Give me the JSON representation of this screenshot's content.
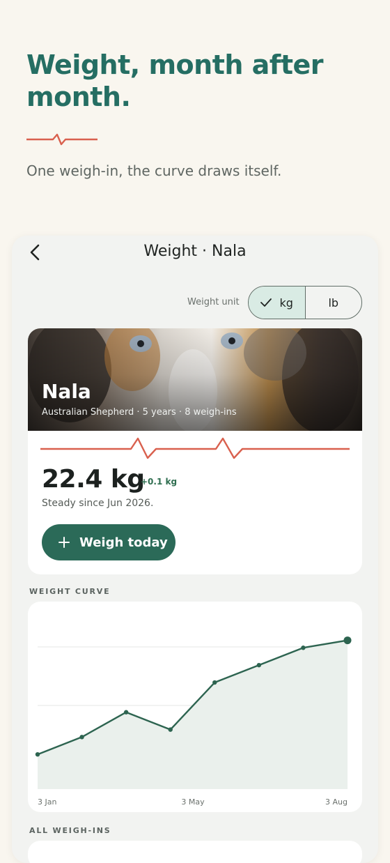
{
  "hero": {
    "title": "Weight, month after month.",
    "subtitle": "One weigh-in, the curve draws itself."
  },
  "screen": {
    "title": "Weight · Nala",
    "unit_label": "Weight unit",
    "units": [
      {
        "label": "kg",
        "selected": true
      },
      {
        "label": "lb",
        "selected": false
      }
    ]
  },
  "pet": {
    "name": "Nala",
    "meta": "Australian Shepherd · 5 years · 8 weigh-ins",
    "weight": "22.4 kg",
    "delta": "+0.1 kg",
    "status": "Steady since Jun 2026."
  },
  "actions": {
    "weigh_today": "Weigh today"
  },
  "sections": {
    "weight_curve": "WEIGHT CURVE",
    "all_weighins": "ALL WEIGH-INS"
  },
  "colors": {
    "accent": "#256e63",
    "button": "#2b6a58",
    "pulse": "#d9604e",
    "line": "#2d6450",
    "area": "#eaf0ec",
    "delta": "#2f6e50"
  },
  "icons": {
    "back": "chevron-left-icon",
    "check": "check-icon",
    "plus": "plus-icon"
  },
  "chart_data": {
    "type": "line",
    "x_tick_labels": [
      "3 Jan",
      "3 May",
      "3 Aug"
    ],
    "series": [
      {
        "values": [
          20.4,
          21.1,
          22.1,
          21.4,
          23.3,
          24.0,
          24.7,
          25.0
        ]
      }
    ],
    "ylim": [
      19,
      26
    ],
    "grid": true,
    "area_fill": true,
    "last_point_highlighted": true
  }
}
